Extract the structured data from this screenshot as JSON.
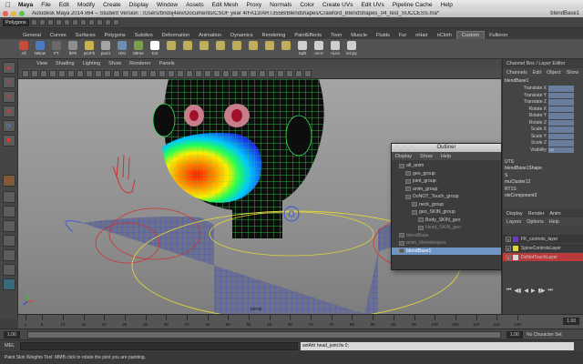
{
  "menubar": {
    "apple": "",
    "app": "Maya",
    "items": [
      "File",
      "Edit",
      "Modify",
      "Create",
      "Display",
      "Window",
      "Assets",
      "Edit Mesh",
      "Proxy",
      "Normals",
      "Color",
      "Create UVs",
      "Edit UVs",
      "Pipeline Cache",
      "Help"
    ]
  },
  "titlebar": {
    "title": "Autodesk Maya 2014 x64 – Student Version : /Users/bridoj4eiv/Documents/CSUF year 4/FA13/ART355B/Blendshapes/Crawford_BlendShapes_04_test_SUCCESS.ma*",
    "selection": "blendBase1"
  },
  "statusline": {
    "mode": "Polygons"
  },
  "shelf": {
    "tabs": [
      "General",
      "Curves",
      "Surfaces",
      "Polygons",
      "Subdivs",
      "Deformation",
      "Animation",
      "Dynamics",
      "Rendering",
      "PaintEffects",
      "Toon",
      "Muscle",
      "Fluids",
      "Fur",
      "nHair",
      "nCloth",
      "Custom",
      "Fulleron"
    ],
    "active_tab": "Custom",
    "tools": [
      {
        "label": "All",
        "color": "#c84b3b"
      },
      {
        "label": "NBow",
        "color": "#4b79c2"
      },
      {
        "label": "FT",
        "color": "#6a6a6a"
      },
      {
        "label": "ft/Fk",
        "color": "#8e8e8e"
      },
      {
        "label": "ptc/Fk",
        "color": "#c9b34a"
      },
      {
        "label": "pwCt",
        "color": "#a5a5a5"
      },
      {
        "label": "Hlst",
        "color": "#6a8fb0"
      },
      {
        "label": "Mtree",
        "color": "#7aa04a"
      },
      {
        "label": "Ext",
        "color": "#ffffff"
      },
      {
        "label": "",
        "color": "#bfae5a"
      },
      {
        "label": "",
        "color": "#bfae5a"
      },
      {
        "label": "",
        "color": "#bfae5a"
      },
      {
        "label": "",
        "color": "#bfae5a"
      },
      {
        "label": "",
        "color": "#bfae5a"
      },
      {
        "label": "",
        "color": "#bfae5a"
      },
      {
        "label": "",
        "color": "#bfae5a"
      },
      {
        "label": "",
        "color": "#bfae5a"
      },
      {
        "label": "Split",
        "color": "#cfcfcf"
      },
      {
        "label": "recV",
        "color": "#cfcfcf"
      },
      {
        "label": "nList",
        "color": "#cfcfcf"
      },
      {
        "label": "leCpy",
        "color": "#cfcfcf"
      }
    ]
  },
  "panel": {
    "menus": [
      "View",
      "Shading",
      "Lighting",
      "Show",
      "Renderer",
      "Panels"
    ],
    "label": "persp"
  },
  "channelbox": {
    "tabs_header": "Channel Box / Layer Editor",
    "menus": [
      "Channels",
      "Edit",
      "Object",
      "Show"
    ],
    "node": "blendBase1",
    "attrs": [
      "Translate X",
      "Translate Y",
      "Translate Z",
      "Rotate X",
      "Rotate Y",
      "Rotate Z",
      "Scale X",
      "Scale Y",
      "Scale Z",
      "Visibility"
    ],
    "visibility_value": "on",
    "sections": [
      "UTS",
      "blendBase1Shape",
      "S",
      "muCluster12",
      "RT1S",
      "oleComponent3"
    ]
  },
  "layers": {
    "tabs": [
      "Display",
      "Render",
      "Anim"
    ],
    "menus": [
      "Layers",
      "Options",
      "Help"
    ],
    "rows": [
      {
        "name": "FK_controls_layer",
        "color": "#6a3dbf",
        "selected": false
      },
      {
        "name": "SpineControlsLayer",
        "color": "#e3d53a",
        "selected": false
      },
      {
        "name": "DoNotTouchLayer",
        "color": "#d7d7d7",
        "selected": true
      }
    ]
  },
  "outliner": {
    "title": "Outliner",
    "menus": [
      "Display",
      "Show",
      "Help"
    ],
    "rows": [
      {
        "name": "all_anim",
        "indent": 0,
        "dim": false,
        "sel": false
      },
      {
        "name": "geo_group",
        "indent": 1,
        "dim": false,
        "sel": false
      },
      {
        "name": "joint_group",
        "indent": 1,
        "dim": false,
        "sel": false
      },
      {
        "name": "anim_group",
        "indent": 1,
        "dim": false,
        "sel": false
      },
      {
        "name": "DoNOT_Touch_group",
        "indent": 1,
        "dim": false,
        "sel": false
      },
      {
        "name": "neck_group",
        "indent": 2,
        "dim": false,
        "sel": false
      },
      {
        "name": "geo_SKIN_group",
        "indent": 2,
        "dim": false,
        "sel": false
      },
      {
        "name": "Body_SKIN_geo",
        "indent": 3,
        "dim": false,
        "sel": false
      },
      {
        "name": "Head_SKIN_geo",
        "indent": 3,
        "dim": true,
        "sel": false
      },
      {
        "name": "blendBase",
        "indent": 0,
        "dim": true,
        "sel": false
      },
      {
        "name": "anim_blendshapes",
        "indent": 0,
        "dim": true,
        "sel": false
      },
      {
        "name": "blendBase1",
        "indent": 0,
        "dim": false,
        "sel": true
      }
    ]
  },
  "viewport": {
    "label": "persp"
  },
  "timeline": {
    "ticks": [
      1,
      5,
      10,
      15,
      20,
      25,
      30,
      35,
      40,
      45,
      50,
      55,
      60,
      65,
      70,
      75,
      80,
      85,
      90,
      95,
      100,
      105,
      110,
      115,
      120
    ],
    "current_frame": "1.00"
  },
  "range": {
    "start": "1.00",
    "end": "1.00",
    "character_set": "No Character Set"
  },
  "cmdline": {
    "lang": "MEL",
    "result": "setAttr head_joint.fw 0;"
  },
  "helpline": {
    "text": "Paint Skin Weights Tool: MMB click to rotate the joint you are painting."
  }
}
